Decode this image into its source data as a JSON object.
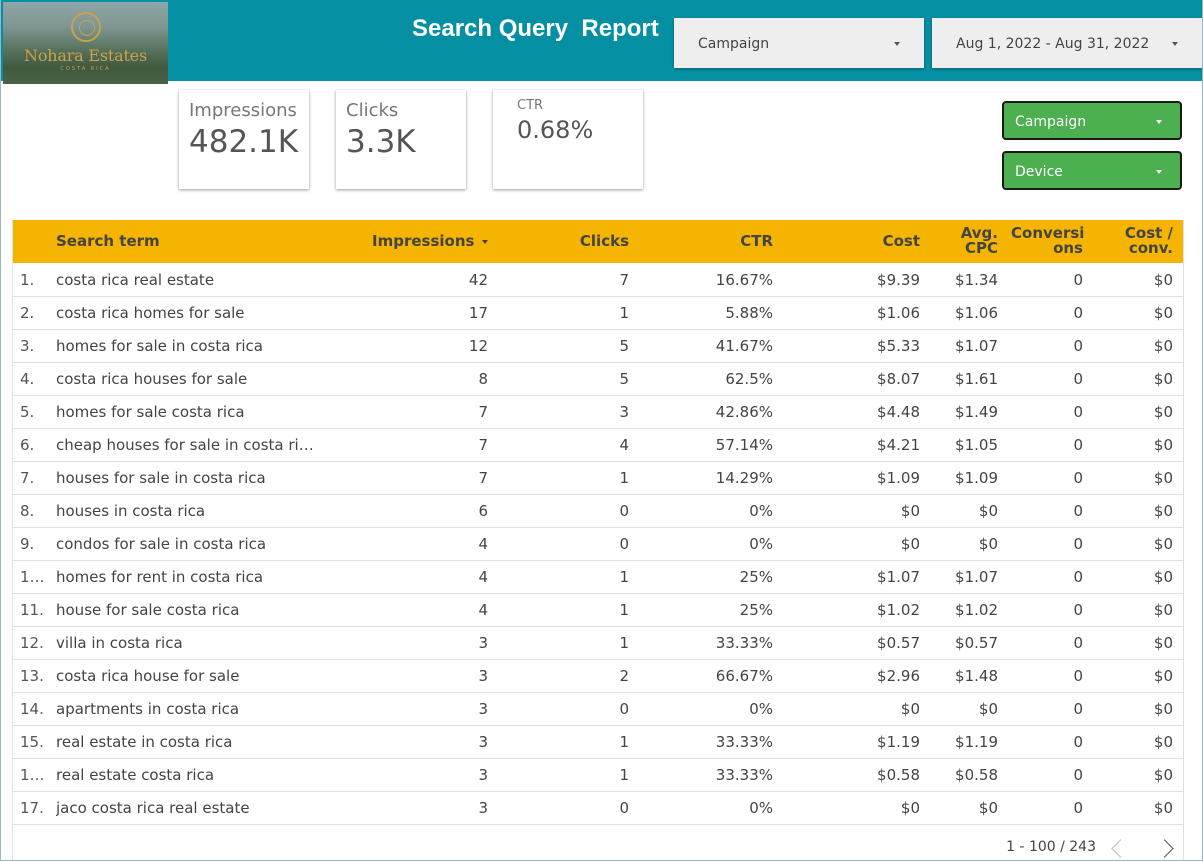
{
  "logo": {
    "brand": "Nohara Estates",
    "sub": "COSTA RICA"
  },
  "title": "Search Query  Report",
  "filters": {
    "campaign": "Campaign",
    "date_range": "Aug 1, 2022 - Aug 31, 2022"
  },
  "kpis": {
    "impressions": {
      "label": "Impressions",
      "value": "482.1K"
    },
    "clicks": {
      "label": "Clicks",
      "value": "3.3K"
    },
    "ctr": {
      "label": "CTR",
      "value": "0.68%"
    }
  },
  "controls": {
    "campaign": "Campaign",
    "device": "Device"
  },
  "colors": {
    "header": "#058fa3",
    "table_header": "#f4b400",
    "control": "#4caf50"
  },
  "table": {
    "columns": {
      "search_term": "Search term",
      "impressions": "Impressions",
      "clicks": "Clicks",
      "ctr": "CTR",
      "cost": "Cost",
      "avg_cpc": "Avg. CPC",
      "conversions": "Conversi ons",
      "cost_conv": "Cost / conv."
    },
    "sorted_by": "Impressions",
    "rows": [
      [
        "1.",
        "costa rica real estate",
        "42",
        "7",
        "16.67%",
        "$9.39",
        "$1.34",
        "0",
        "$0"
      ],
      [
        "2.",
        "costa rica homes for sale",
        "17",
        "1",
        "5.88%",
        "$1.06",
        "$1.06",
        "0",
        "$0"
      ],
      [
        "3.",
        "homes for sale in costa rica",
        "12",
        "5",
        "41.67%",
        "$5.33",
        "$1.07",
        "0",
        "$0"
      ],
      [
        "4.",
        "costa rica houses for sale",
        "8",
        "5",
        "62.5%",
        "$8.07",
        "$1.61",
        "0",
        "$0"
      ],
      [
        "5.",
        "homes for sale costa rica",
        "7",
        "3",
        "42.86%",
        "$4.48",
        "$1.49",
        "0",
        "$0"
      ],
      [
        "6.",
        "cheap houses for sale in costa ric…",
        "7",
        "4",
        "57.14%",
        "$4.21",
        "$1.05",
        "0",
        "$0"
      ],
      [
        "7.",
        "houses for sale in costa rica",
        "7",
        "1",
        "14.29%",
        "$1.09",
        "$1.09",
        "0",
        "$0"
      ],
      [
        "8.",
        "houses in costa rica",
        "6",
        "0",
        "0%",
        "$0",
        "$0",
        "0",
        "$0"
      ],
      [
        "9.",
        "condos for sale in costa rica",
        "4",
        "0",
        "0%",
        "$0",
        "$0",
        "0",
        "$0"
      ],
      [
        "1…",
        "homes for rent in costa rica",
        "4",
        "1",
        "25%",
        "$1.07",
        "$1.07",
        "0",
        "$0"
      ],
      [
        "11.",
        "house for sale costa rica",
        "4",
        "1",
        "25%",
        "$1.02",
        "$1.02",
        "0",
        "$0"
      ],
      [
        "12.",
        "villa in costa rica",
        "3",
        "1",
        "33.33%",
        "$0.57",
        "$0.57",
        "0",
        "$0"
      ],
      [
        "13.",
        "costa rica house for sale",
        "3",
        "2",
        "66.67%",
        "$2.96",
        "$1.48",
        "0",
        "$0"
      ],
      [
        "14.",
        "apartments in costa rica",
        "3",
        "0",
        "0%",
        "$0",
        "$0",
        "0",
        "$0"
      ],
      [
        "15.",
        "real estate in costa rica",
        "3",
        "1",
        "33.33%",
        "$1.19",
        "$1.19",
        "0",
        "$0"
      ],
      [
        "1…",
        "real estate costa rica",
        "3",
        "1",
        "33.33%",
        "$0.58",
        "$0.58",
        "0",
        "$0"
      ],
      [
        "17.",
        "jaco costa rica real estate",
        "3",
        "0",
        "0%",
        "$0",
        "$0",
        "0",
        "$0"
      ]
    ],
    "pagination": "1 - 100 / 243"
  }
}
